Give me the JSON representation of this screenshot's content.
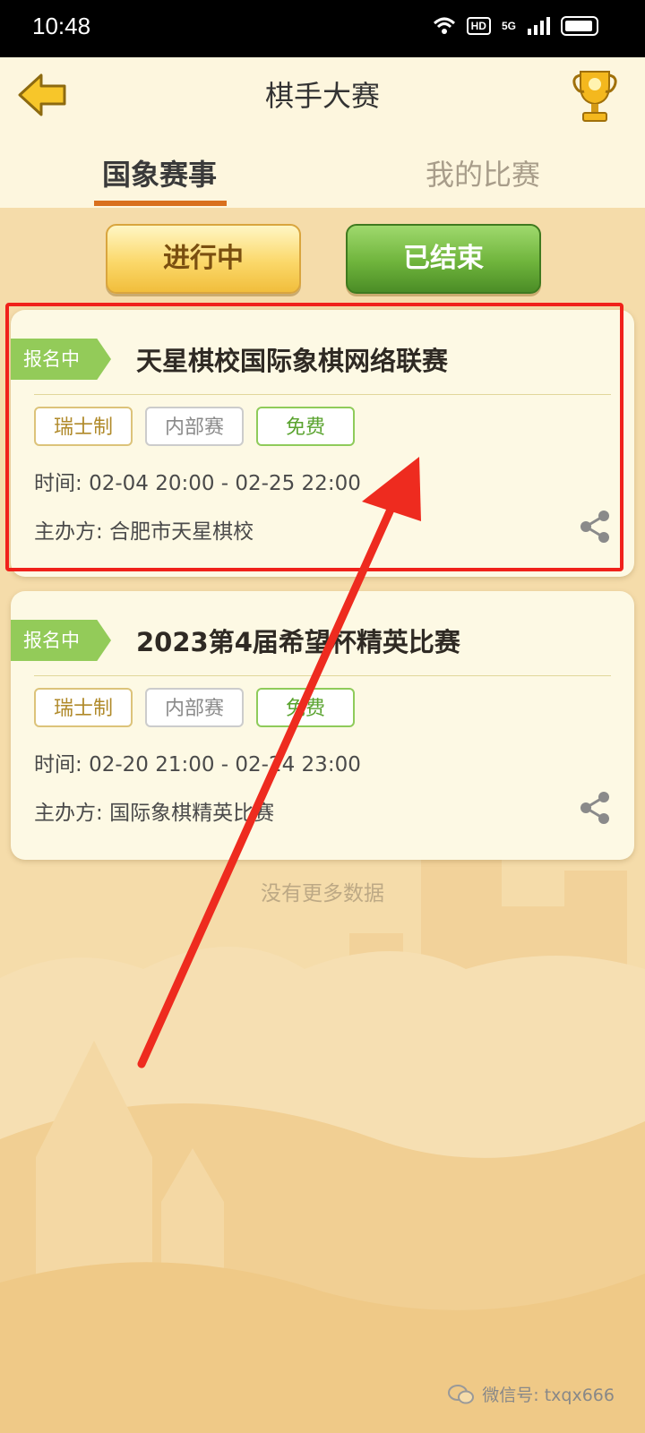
{
  "status_bar": {
    "time": "10:48",
    "hd": "HD",
    "network": "5G",
    "icons": [
      "wifi-icon",
      "hd-icon",
      "signal-icon",
      "battery-icon"
    ]
  },
  "header": {
    "title": "棋手大赛",
    "back_icon": "back-arrow-icon",
    "trophy_icon": "trophy-icon"
  },
  "tabs": [
    {
      "label": "国象赛事",
      "active": true
    },
    {
      "label": "我的比赛",
      "active": false
    }
  ],
  "filters": {
    "ongoing": "进行中",
    "ended": "已结束"
  },
  "cards": [
    {
      "status": "报名中",
      "title": "天星棋校国际象棋网络联赛",
      "tags": [
        "瑞士制",
        "内部赛",
        "免费"
      ],
      "time_label": "时间:",
      "time_value": "02-04 20:00 - 02-25 22:00",
      "organizer_label": "主办方:",
      "organizer_value": "合肥市天星棋校",
      "highlighted": true
    },
    {
      "status": "报名中",
      "title": "2023第4届希望杯精英比赛",
      "tags": [
        "瑞士制",
        "内部赛",
        "免费"
      ],
      "time_label": "时间:",
      "time_value": "02-20 21:00 - 02-24 23:00",
      "organizer_label": "主办方:",
      "organizer_value": "国际象棋精英比赛",
      "highlighted": false
    }
  ],
  "footer_text": "没有更多数据",
  "watermark": "微信号: txqx666",
  "colors": {
    "accent_orange": "#d9701e",
    "status_green": "#93cb59",
    "highlight_red": "#f0211a"
  }
}
